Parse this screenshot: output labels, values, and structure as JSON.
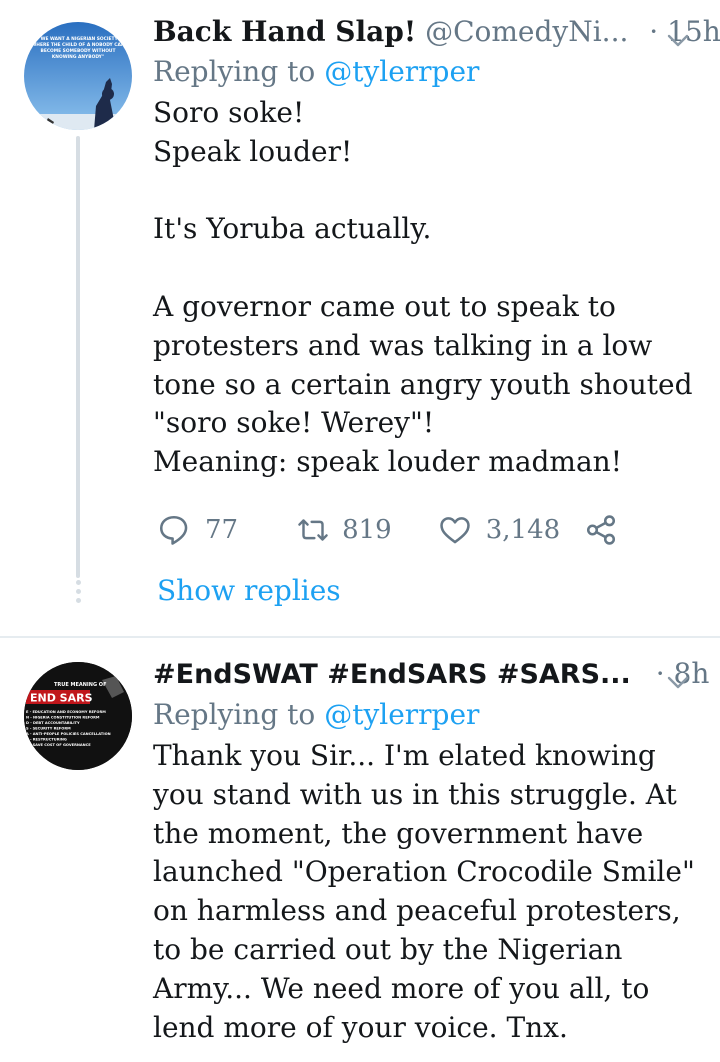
{
  "tweets": [
    {
      "display_name": "Back Hand Slap!",
      "handle": "@ComedyNi...",
      "time": "· 15h",
      "reply_prefix": "Replying to",
      "reply_to": "@tylerrper",
      "body": "Soro soke!\nSpeak louder!\n\nIt's Yoruba actually.\n\nA governor came out to speak to protesters and was talking in a low tone so a certain angry youth shouted \"soro soke! Werey\"!\nMeaning: speak louder madman!",
      "replies": "77",
      "retweets": "819",
      "likes": "3,148",
      "avatar_text": "\"WE WANT A NIGERIAN SOCIETY WHERE THE CHILD OF A NOBODY CAN BECOME SOMEBODY WITHOUT KNOWING ANYBODY\""
    },
    {
      "display_name": "#EndSWAT #EndSARS #SARS...",
      "time": "· 8h",
      "reply_prefix": "Replying to",
      "reply_to": "@tylerrper",
      "body": "Thank you Sir... I'm elated knowing you stand with us in this struggle. At the moment, the government have launched \"Operation Crocodile Smile\" on harmless and peaceful protesters, to be carried out by the Nigerian Army... We need more of you all, to lend more of your voice. Tnx.",
      "avatar_lines": [
        "TRUE MEANING OF",
        "END SARS",
        "E - EDUCATION AND ECONOMY REFORM",
        "N - NIGERIA CONSTITUTION REFORM",
        "D - DEBT ACCOUNTABILITY",
        "S - SECURITY REFORM",
        "A - ANTI-PEOPLE POLICIES CANCELLATION",
        "R - RESTRUCTURING",
        "S - SAVE COST OF GOVERNANCE"
      ]
    }
  ],
  "show_replies": "Show replies",
  "colors": {
    "accent": "#1da1f2",
    "secondary": "#657786",
    "divider": "#e6ecf0"
  },
  "icons": [
    "reply-icon",
    "retweet-icon",
    "like-icon",
    "share-icon",
    "chevron-down-icon"
  ]
}
